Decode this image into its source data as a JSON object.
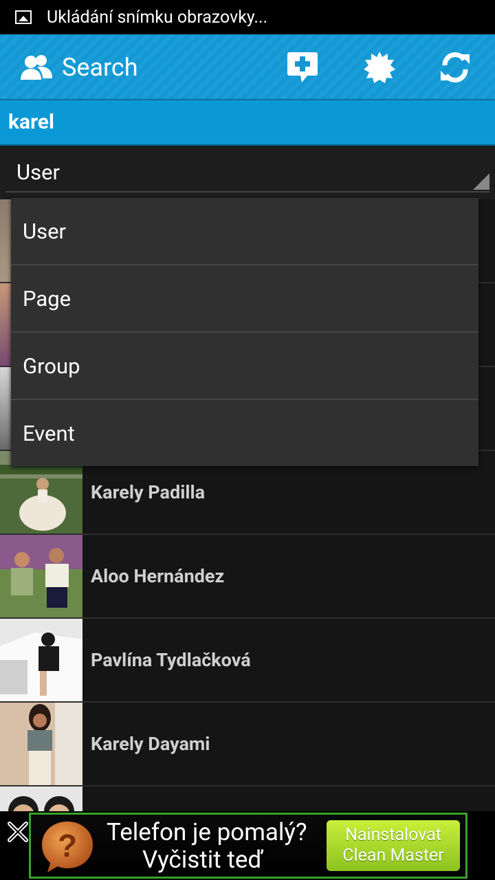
{
  "status_bar": {
    "text": "Ukládání snímku obrazovky..."
  },
  "action_bar": {
    "title": "Search"
  },
  "search": {
    "query": "karel"
  },
  "spinner": {
    "selected": "User"
  },
  "dropdown": {
    "options": [
      "User",
      "Page",
      "Group",
      "Event"
    ]
  },
  "results": [
    {
      "name": ""
    },
    {
      "name": ""
    },
    {
      "name": ""
    },
    {
      "name": "Karely Padilla"
    },
    {
      "name": "Aloo Hernández"
    },
    {
      "name": "Pavlína Tydlačková"
    },
    {
      "name": "Karely Dayami"
    },
    {
      "name": ""
    }
  ],
  "ad": {
    "line1": "Telefon je pomalý?",
    "line2": "Vyčistit teď",
    "button_line1": "Nainstalovat",
    "button_line2": "Clean Master"
  },
  "colors": {
    "action_bar": "#1597d3",
    "search_bar": "#0a99d6",
    "background": "#151515",
    "dropdown": "#303030",
    "ad_button": "#8dc21f"
  }
}
